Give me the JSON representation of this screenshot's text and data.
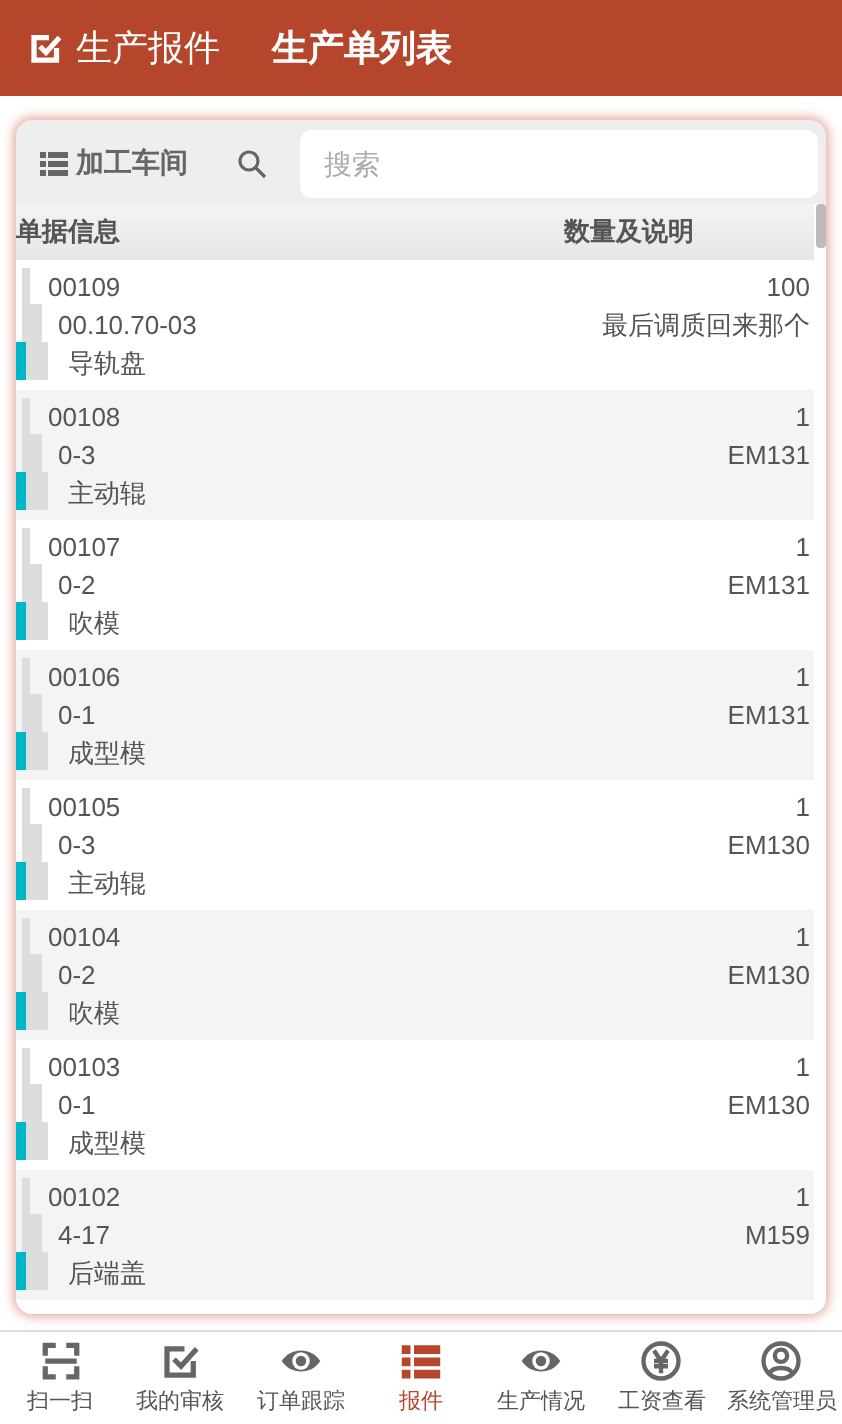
{
  "header": {
    "app_title": "生产报件",
    "page_title": "生产单列表"
  },
  "toolbar": {
    "filter": "加工车间",
    "search": {
      "placeholder": "搜索"
    }
  },
  "table": {
    "columns": [
      "单据信息",
      "数量及说明"
    ],
    "rows": [
      {
        "number": "00109",
        "code": "00.10.70-03",
        "part": "导轨盘",
        "quantity": "100",
        "note": "最后调质回来那个"
      },
      {
        "number": "00108",
        "code": "0-3",
        "part": "主动辊",
        "quantity": "1",
        "note": "EM131"
      },
      {
        "number": "00107",
        "code": "0-2",
        "part": "吹模",
        "quantity": "1",
        "note": "EM131"
      },
      {
        "number": "00106",
        "code": "0-1",
        "part": "成型模",
        "quantity": "1",
        "note": "EM131"
      },
      {
        "number": "00105",
        "code": "0-3",
        "part": "主动辊",
        "quantity": "1",
        "note": "EM130"
      },
      {
        "number": "00104",
        "code": "0-2",
        "part": "吹模",
        "quantity": "1",
        "note": "EM130"
      },
      {
        "number": "00103",
        "code": "0-1",
        "part": "成型模",
        "quantity": "1",
        "note": "EM130"
      },
      {
        "number": "00102",
        "code": "4-17",
        "part": "后端盖",
        "quantity": "1",
        "note": "M159"
      }
    ]
  },
  "nav": [
    {
      "label": "扫一扫",
      "kind": "scan",
      "selected": false
    },
    {
      "label": "我的审核",
      "kind": "check",
      "selected": false
    },
    {
      "label": "订单跟踪",
      "kind": "eye",
      "selected": false
    },
    {
      "label": "报件",
      "kind": "list",
      "selected": true
    },
    {
      "label": "生产情况",
      "kind": "eye",
      "selected": false
    },
    {
      "label": "工资查看",
      "kind": "yen",
      "selected": false
    },
    {
      "label": "系统管理员",
      "kind": "user",
      "selected": false
    }
  ]
}
